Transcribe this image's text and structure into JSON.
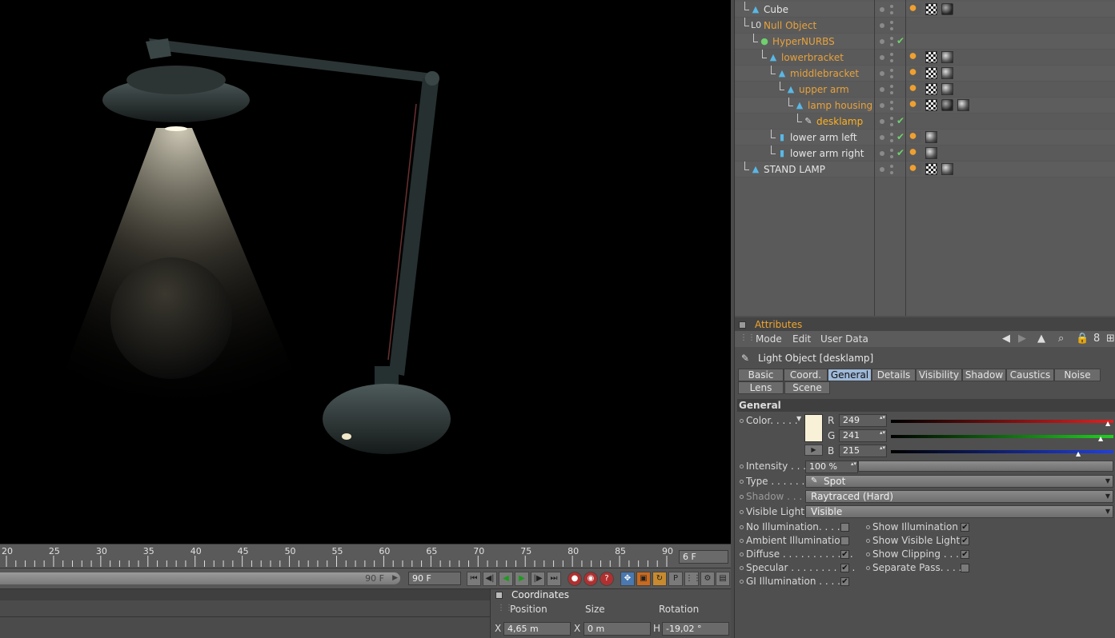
{
  "viewport": {
    "background": "#000000"
  },
  "timeline": {
    "ticks": [
      "20",
      "25",
      "30",
      "35",
      "40",
      "45",
      "50",
      "55",
      "60",
      "65",
      "70",
      "75",
      "80",
      "85",
      "90"
    ],
    "current_frame": "6 F",
    "slider_label": "90 F",
    "end_frame": "90 F"
  },
  "coordinates": {
    "title": "Coordinates",
    "headers": {
      "position": "Position",
      "size": "Size",
      "rotation": "Rotation"
    },
    "pos_axis": "X",
    "pos_value": "4,65 m",
    "size_axis": "X",
    "size_value": "0 m",
    "rot_axis": "H",
    "rot_value": "-19,02 °"
  },
  "objects": [
    {
      "name": "Cube",
      "style": "white"
    },
    {
      "name": "Null Object",
      "style": "orange"
    },
    {
      "name": "HyperNURBS",
      "style": "orange"
    },
    {
      "name": "lowerbracket",
      "style": "orange"
    },
    {
      "name": "middlebracket",
      "style": "orange"
    },
    {
      "name": "upper arm",
      "style": "orange"
    },
    {
      "name": "lamp housing",
      "style": "orange"
    },
    {
      "name": "desklamp",
      "style": "selected"
    },
    {
      "name": "lower arm left",
      "style": "white"
    },
    {
      "name": "lower arm right",
      "style": "white"
    },
    {
      "name": "STAND LAMP",
      "style": "white"
    }
  ],
  "attributes": {
    "title": "Attributes",
    "menu": {
      "mode": "Mode",
      "edit": "Edit",
      "user_data": "User Data"
    },
    "object_label": "Light Object [desklamp]",
    "tabs_row1": [
      "Basic",
      "Coord.",
      "General",
      "Details",
      "Visibility",
      "Shadow",
      "Caustics",
      "Noise"
    ],
    "tabs_row2": [
      "Lens",
      "Scene"
    ],
    "active_tab": "General",
    "section": "General",
    "color": {
      "label": "Color. . . . .",
      "r_label": "R",
      "r": "249",
      "g_label": "G",
      "g": "241",
      "b_label": "B",
      "b": "215",
      "hex": "#f9f1d7"
    },
    "intensity": {
      "label": "Intensity . . . .",
      "value": "100 %"
    },
    "type": {
      "label": "Type . . . . . . .",
      "value": "Spot"
    },
    "shadow": {
      "label": "Shadow . . . .",
      "value": "Raytraced (Hard)"
    },
    "visible_light": {
      "label": "Visible Light",
      "value": "Visible"
    },
    "checks_left": [
      {
        "label": "No Illumination. . . . .",
        "checked": false
      },
      {
        "label": "Ambient Illumination",
        "checked": false
      },
      {
        "label": "Diffuse . . . . . . . . . . . .",
        "checked": true
      },
      {
        "label": "Specular . . . . . . . . . . .",
        "checked": true
      },
      {
        "label": "GI Illumination . . . . .",
        "checked": true
      }
    ],
    "checks_right": [
      {
        "label": "Show Illumination",
        "checked": true
      },
      {
        "label": "Show Visible Light",
        "checked": true
      },
      {
        "label": "Show Clipping . . . .",
        "checked": true
      },
      {
        "label": "Separate Pass. . . . .",
        "checked": false
      }
    ]
  }
}
